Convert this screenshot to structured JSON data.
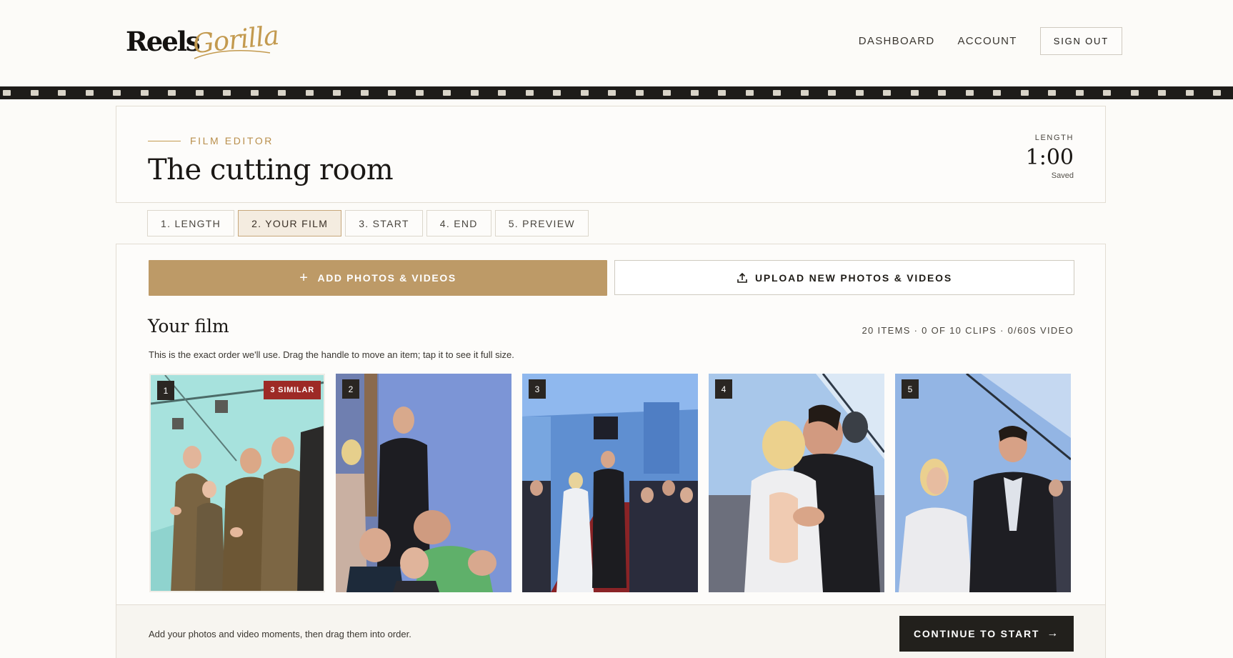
{
  "brand": {
    "name_part1": "Reels",
    "name_part2": "Gorilla"
  },
  "nav": {
    "dashboard": "DASHBOARD",
    "account": "ACCOUNT",
    "signout": "SIGN OUT"
  },
  "editor": {
    "eyebrow": "FILM EDITOR",
    "title": "The cutting room",
    "length_label": "LENGTH",
    "length_value": "1:00",
    "saved_status": "Saved"
  },
  "tabs": [
    {
      "label": "1. LENGTH",
      "active": false
    },
    {
      "label": "2. YOUR FILM",
      "active": true
    },
    {
      "label": "3. START",
      "active": false
    },
    {
      "label": "4. END",
      "active": false
    },
    {
      "label": "5. PREVIEW",
      "active": false
    }
  ],
  "actions": {
    "add_label": "ADD PHOTOS & VIDEOS",
    "upload_label": "UPLOAD NEW PHOTOS & VIDEOS"
  },
  "film": {
    "title": "Your film",
    "counts": "20 ITEMS · 0 OF 10 CLIPS · 0/60S VIDEO",
    "helper": "This is the exact order we'll use. Drag the handle to move an item; tap it to see it full size.",
    "items": [
      {
        "number": "1",
        "badge": "3 SIMILAR",
        "icon": "photo-groomsmen"
      },
      {
        "number": "2",
        "badge": "",
        "icon": "photo-groom-entrance"
      },
      {
        "number": "3",
        "badge": "",
        "icon": "photo-aisle-walk"
      },
      {
        "number": "4",
        "badge": "",
        "icon": "photo-kiss"
      },
      {
        "number": "5",
        "badge": "",
        "icon": "photo-couple"
      }
    ]
  },
  "footer": {
    "hint": "Add your photos and video moments, then drag them into order.",
    "continue_label": "CONTINUE TO START",
    "continue_icon": "arrow-right-icon"
  },
  "colors": {
    "accent": "#bd9a67",
    "dark": "#22201c",
    "badge": "#9d2a26",
    "background": "#fcfbf8"
  }
}
